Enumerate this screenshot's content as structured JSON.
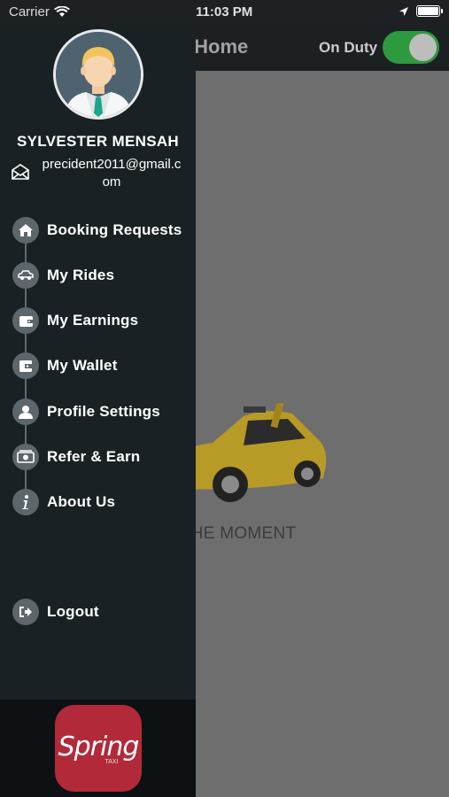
{
  "status_bar": {
    "carrier": "Carrier",
    "time": "11:03 PM"
  },
  "header": {
    "title": "ver Home",
    "duty_label": "On Duty",
    "duty_on": true
  },
  "main": {
    "empty_message": "ESTS AT THE MOMENT"
  },
  "drawer": {
    "user_name": "SYLVESTER MENSAH",
    "email_line1": "precident2011@gmail.c",
    "email_line2": "om",
    "menu": [
      {
        "label": "Booking Requests",
        "icon": "home-icon"
      },
      {
        "label": "My Rides",
        "icon": "car-icon"
      },
      {
        "label": "My Earnings",
        "icon": "wallet-icon"
      },
      {
        "label": "My Wallet",
        "icon": "card-wallet-icon"
      },
      {
        "label": "Profile Settings",
        "icon": "person-icon"
      },
      {
        "label": "Refer & Earn",
        "icon": "money-icon"
      },
      {
        "label": "About Us",
        "icon": "info-icon"
      }
    ],
    "logout_label": "Logout",
    "logo_text": "Spring",
    "logo_sub": "TAXI"
  },
  "colors": {
    "drawer_bg": "#1a2125",
    "toggle_on": "#2d9a3f",
    "logo_red": "#b22a3a"
  }
}
